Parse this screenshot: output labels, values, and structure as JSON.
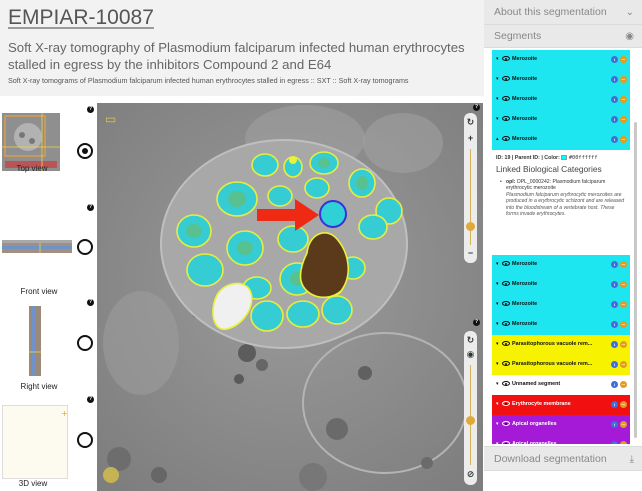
{
  "header": {
    "entry_id": "EMPIAR-10087",
    "title": "Soft X-ray tomography of Plasmodium falciparum infected human erythrocytes stalled in egress by the inhibitors Compound 2 and E64",
    "subtitle": "Soft X-ray tomograms of Plasmodium falciparum infected human erythrocytes stalled in egress :: SXT :: Soft X-ray tomograms"
  },
  "views": {
    "top": "Top view",
    "front": "Front view",
    "right": "Right view",
    "three_d": "3D view",
    "selected": "top",
    "help_glyph": "?"
  },
  "viewer": {
    "plus": "+",
    "minus": "−",
    "refresh": "↻",
    "eye": "◉",
    "hide": "⊘"
  },
  "panel": {
    "about": "About this segmentation",
    "about_icon": "chevron-down-icon",
    "segments": "Segments",
    "segments_icon": "eye-icon",
    "download": "Download segmentation",
    "download_icon": "download-icon"
  },
  "segments_top": [
    {
      "label": "Merozoite",
      "color": "#1de6f0",
      "caret": "▾"
    },
    {
      "label": "Merozoite",
      "color": "#1de6f0",
      "caret": "▾"
    },
    {
      "label": "Merozoite",
      "color": "#1de6f0",
      "caret": "▾"
    },
    {
      "label": "Merozoite",
      "color": "#1de6f0",
      "caret": "▾"
    },
    {
      "label": "Merozoite",
      "color": "#1de6f0",
      "caret": "▴"
    }
  ],
  "segment_detail": {
    "id_line": "ID: 19 | Parent ID: | Color:",
    "color_hex": "#00ffffff",
    "heading": "Linked Biological Categories",
    "ontology_id": "opl:",
    "ontology_text": "OPL_0000242: Plasmodium falciparum erythrocytic merozoite",
    "description": "Plasmodium falciparum erythrocytic merozoites are produced in a erythrocytic schizont and are released into the bloodstream of a vertebrate host. These forms invade erythrocytes."
  },
  "segments_bottom": [
    {
      "label": "Merozoite",
      "color": "#1de6f0",
      "text": "#111111",
      "caret": "▾"
    },
    {
      "label": "Merozoite",
      "color": "#1de6f0",
      "text": "#111111",
      "caret": "▾"
    },
    {
      "label": "Merozoite",
      "color": "#1de6f0",
      "text": "#111111",
      "caret": "▾"
    },
    {
      "label": "Merozoite",
      "color": "#1de6f0",
      "text": "#111111",
      "caret": "▾"
    },
    {
      "label": "Parasitophorous vacuole rem...",
      "color": "#f7f200",
      "text": "#111111",
      "caret": "▾"
    },
    {
      "label": "Parasitophorous vacuole rem...",
      "color": "#f7f200",
      "text": "#111111",
      "caret": "▾"
    },
    {
      "label": "Unnamed segment",
      "color": "#ffffff",
      "text": "#111111",
      "caret": "▾"
    },
    {
      "label": "Erythrocyte membrane",
      "color": "#f20f0f",
      "text": "#ffffff",
      "caret": "▾"
    },
    {
      "label": "Apical organelles",
      "color": "#a41ad6",
      "text": "#ffffff",
      "caret": "▾"
    },
    {
      "label": "Apical organelles",
      "color": "#a41ad6",
      "text": "#ffffff",
      "caret": "▾"
    }
  ],
  "badges": {
    "info": "i",
    "more": "⋯"
  }
}
